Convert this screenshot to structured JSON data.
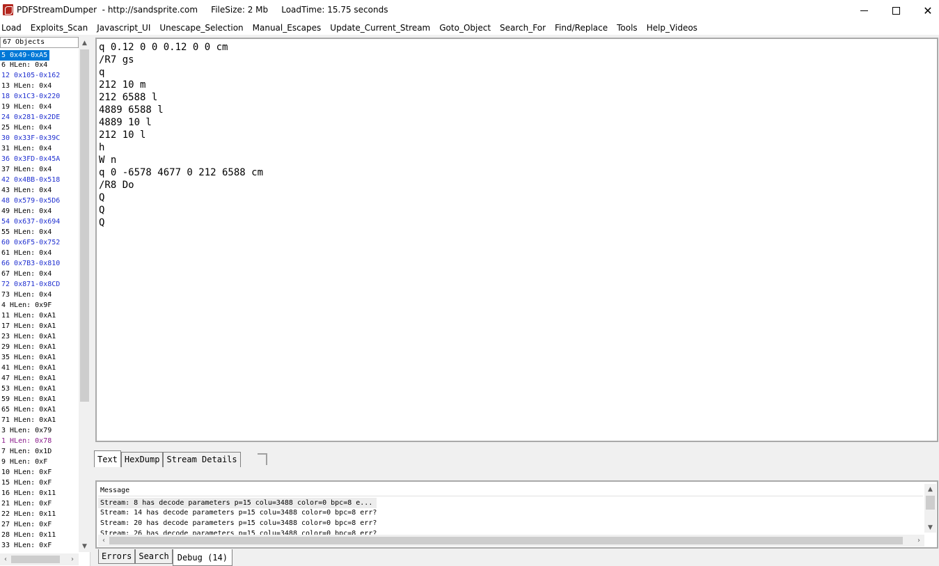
{
  "window": {
    "title": "PDFStreamDumper  - http://sandsprite.com     FileSize: 2 Mb     LoadTime: 15.75 seconds"
  },
  "menu": [
    "Load",
    "Exploits_Scan",
    "Javascript_UI",
    "Unescape_Selection",
    "Manual_Escapes",
    "Update_Current_Stream",
    "Goto_Object",
    "Search_For",
    "Find/Replace",
    "Tools",
    "Help_Videos"
  ],
  "object_list": {
    "header": "67 Objects",
    "items": [
      {
        "text": "5 0x49-0xA5",
        "color": "selected"
      },
      {
        "text": "6 HLen: 0x4",
        "color": "black"
      },
      {
        "text": "12 0x105-0x162",
        "color": "blue"
      },
      {
        "text": "13 HLen: 0x4",
        "color": "black"
      },
      {
        "text": "18 0x1C3-0x220",
        "color": "blue"
      },
      {
        "text": "19 HLen: 0x4",
        "color": "black"
      },
      {
        "text": "24 0x281-0x2DE",
        "color": "blue"
      },
      {
        "text": "25 HLen: 0x4",
        "color": "black"
      },
      {
        "text": "30 0x33F-0x39C",
        "color": "blue"
      },
      {
        "text": "31 HLen: 0x4",
        "color": "black"
      },
      {
        "text": "36 0x3FD-0x45A",
        "color": "blue"
      },
      {
        "text": "37 HLen: 0x4",
        "color": "black"
      },
      {
        "text": "42 0x4BB-0x518",
        "color": "blue"
      },
      {
        "text": "43 HLen: 0x4",
        "color": "black"
      },
      {
        "text": "48 0x579-0x5D6",
        "color": "blue"
      },
      {
        "text": "49 HLen: 0x4",
        "color": "black"
      },
      {
        "text": "54 0x637-0x694",
        "color": "blue"
      },
      {
        "text": "55 HLen: 0x4",
        "color": "black"
      },
      {
        "text": "60 0x6F5-0x752",
        "color": "blue"
      },
      {
        "text": "61 HLen: 0x4",
        "color": "black"
      },
      {
        "text": "66 0x7B3-0x810",
        "color": "blue"
      },
      {
        "text": "67 HLen: 0x4",
        "color": "black"
      },
      {
        "text": "72 0x871-0x8CD",
        "color": "blue"
      },
      {
        "text": "73 HLen: 0x4",
        "color": "black"
      },
      {
        "text": "4 HLen: 0x9F",
        "color": "black"
      },
      {
        "text": "11 HLen: 0xA1",
        "color": "black"
      },
      {
        "text": "17 HLen: 0xA1",
        "color": "black"
      },
      {
        "text": "23 HLen: 0xA1",
        "color": "black"
      },
      {
        "text": "29 HLen: 0xA1",
        "color": "black"
      },
      {
        "text": "35 HLen: 0xA1",
        "color": "black"
      },
      {
        "text": "41 HLen: 0xA1",
        "color": "black"
      },
      {
        "text": "47 HLen: 0xA1",
        "color": "black"
      },
      {
        "text": "53 HLen: 0xA1",
        "color": "black"
      },
      {
        "text": "59 HLen: 0xA1",
        "color": "black"
      },
      {
        "text": "65 HLen: 0xA1",
        "color": "black"
      },
      {
        "text": "71 HLen: 0xA1",
        "color": "black"
      },
      {
        "text": "3 HLen: 0x79",
        "color": "black"
      },
      {
        "text": "1 HLen: 0x78",
        "color": "purple"
      },
      {
        "text": "7 HLen: 0x1D",
        "color": "black"
      },
      {
        "text": "9 HLen: 0xF",
        "color": "black"
      },
      {
        "text": "10 HLen: 0xF",
        "color": "black"
      },
      {
        "text": "15 HLen: 0xF",
        "color": "black"
      },
      {
        "text": "16 HLen: 0x11",
        "color": "black"
      },
      {
        "text": "21 HLen: 0xF",
        "color": "black"
      },
      {
        "text": "22 HLen: 0x11",
        "color": "black"
      },
      {
        "text": "27 HLen: 0xF",
        "color": "black"
      },
      {
        "text": "28 HLen: 0x11",
        "color": "black"
      },
      {
        "text": "33 HLen: 0xF",
        "color": "black"
      }
    ]
  },
  "stream_text": [
    "q 0.12 0 0 0.12 0 0 cm",
    "/R7 gs",
    "q",
    "212 10 m",
    "212 6588 l",
    "4889 6588 l",
    "4889 10 l",
    "212 10 l",
    "h",
    "W n",
    "q 0 -6578 4677 0 212 6588 cm",
    "/R8 Do",
    "Q",
    "Q",
    "Q"
  ],
  "view_tabs": [
    "Text",
    "HexDump",
    "Stream Details"
  ],
  "active_view_tab": "Text",
  "message_panel": {
    "header": "Message",
    "rows": [
      "Stream: 8 has decode parameters p=15 colu=3488 color=0 bpc=8 e...",
      "Stream: 14 has decode parameters p=15 colu=3488 color=0 bpc=8 err?",
      "Stream: 20 has decode parameters p=15 colu=3488 color=0 bpc=8 err?",
      "Stream: 26 has decode parameters p=15 colu=3488 color=0 bpc=8 err?"
    ]
  },
  "bottom_tabs": [
    "Errors",
    "Search",
    "Debug (14)"
  ],
  "active_bottom_tab": "Debug (14)",
  "colors": {
    "selection": "#0078d7",
    "object_blue": "#1f2fd0",
    "object_purple": "#8a1a8a",
    "app_icon": "#b3261e"
  }
}
